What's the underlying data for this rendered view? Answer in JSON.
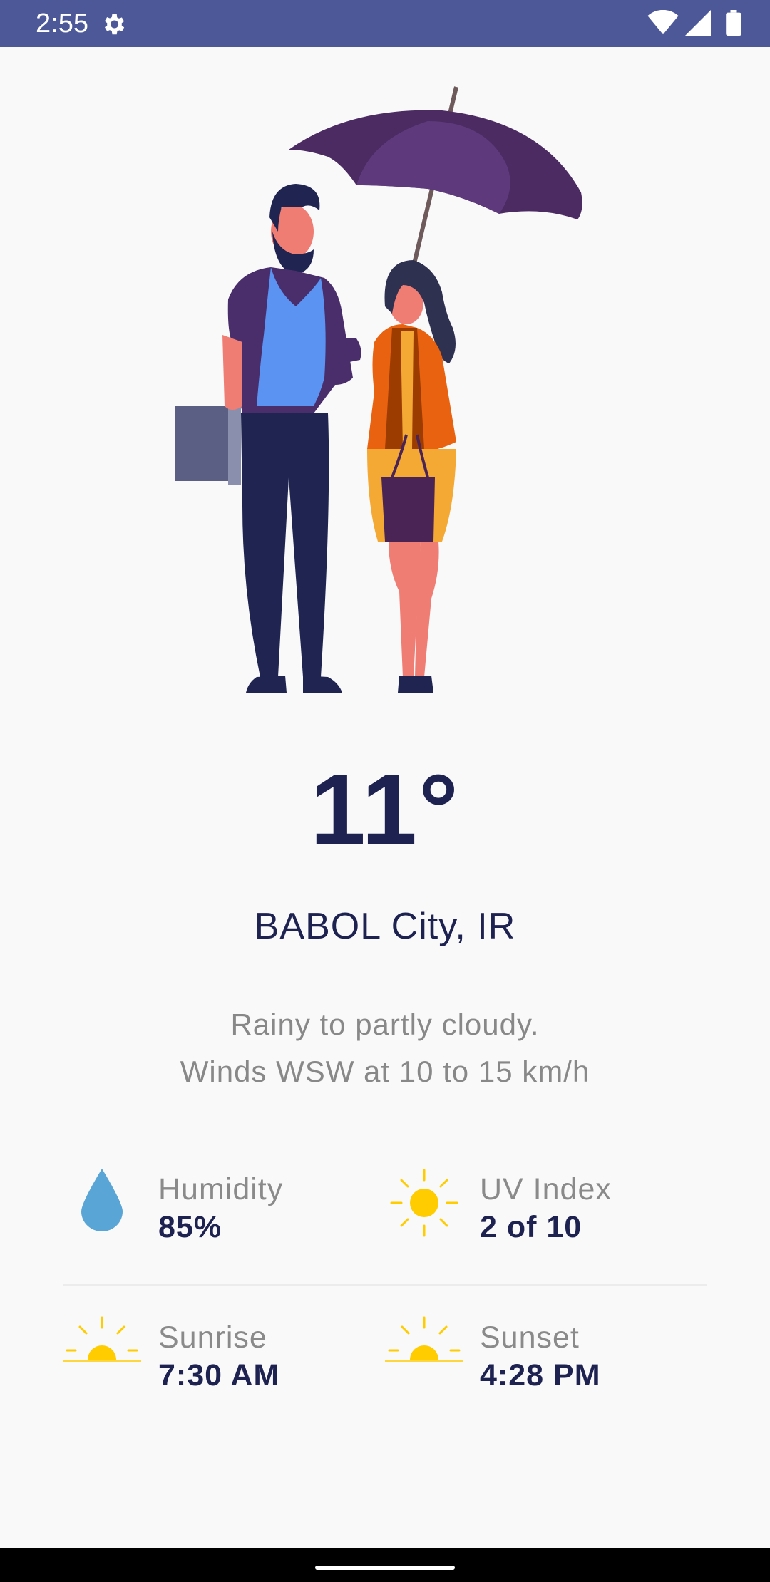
{
  "status_bar": {
    "time": "2:55",
    "icons": [
      "settings-gear",
      "wifi",
      "cellular-signal",
      "battery"
    ]
  },
  "weather": {
    "temperature": "11°",
    "location": "BABOL City, IR",
    "description_line1": "Rainy to partly cloudy.",
    "description_line2": "Winds WSW at 10 to 15 km/h"
  },
  "stats": {
    "humidity": {
      "label": "Humidity",
      "value": "85%",
      "icon": "water-drop"
    },
    "uv_index": {
      "label": "UV Index",
      "value": "2 of 10",
      "icon": "sun"
    },
    "sunrise": {
      "label": "Sunrise",
      "value": "7:30 AM",
      "icon": "sunrise"
    },
    "sunset": {
      "label": "Sunset",
      "value": "4:28 PM",
      "icon": "sunset"
    }
  },
  "colors": {
    "status_bar": "#4c5898",
    "primary_text": "#1e2251",
    "secondary_text": "#888888",
    "sun": "#ffcc00",
    "drop": "#58a5d6"
  }
}
